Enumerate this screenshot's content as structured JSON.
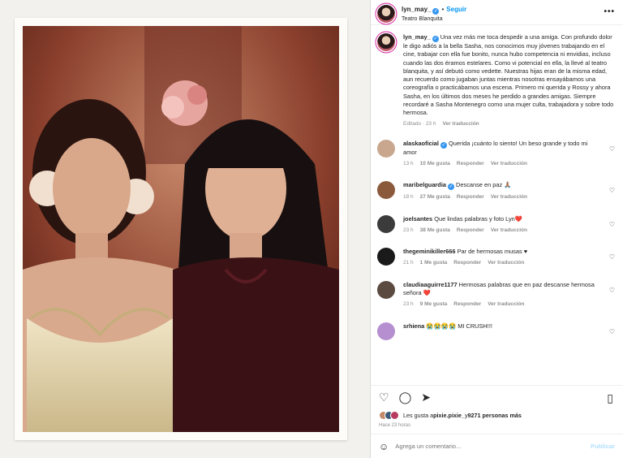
{
  "header": {
    "username": "lyn_may_",
    "follow_label": "Seguir",
    "dot": "•",
    "location": "Teatro Blanquita",
    "more_icon": "more-horizontal-icon"
  },
  "caption": {
    "username": "lyn_may_",
    "text": "Una vez más me toca despedir a una amiga. Con profundo dolor le digo adiós a la bella Sasha, nos conocimos muy jóvenes trabajando en el cine, trabajar con ella fue bonito, nunca hubo competencia ni envidias, incluso cuando las dos éramos estelares. Como vi potencial en ella, la llevé al teatro blanquita, y así debutó como vedette. Nuestras hijas eran de la misma edad, aun recuerdo como jugaban juntas mientras nosotras ensayábamos una coreografía o practicábamos una escena. Primero mi querida y Rossy y ahora Sasha, en los últimos dos meses he perdido a grandes amigas. Siempre recordaré a Sasha Montenegro como una mujer culta, trabajadora y sobre todo hermosa.",
    "edited": "Editado · 23 h",
    "translate": "Ver traducción"
  },
  "comments": [
    {
      "user": "alaskaoficial",
      "verified": true,
      "text": "Querida ¡cuánto lo siento! Un beso grande y todo mi amor",
      "time": "13 h",
      "likes": "10 Me gusta",
      "reply": "Responder",
      "translate": "Ver traducción",
      "avatar_color": "#c9a78f"
    },
    {
      "user": "maribelguardia",
      "verified": true,
      "text": "Descanse en paz 🙏🏽",
      "time": "18 h",
      "likes": "27 Me gusta",
      "reply": "Responder",
      "translate": "Ver traducción",
      "avatar_color": "#8b5a3c"
    },
    {
      "user": "joelsantes",
      "verified": false,
      "text": "Que lindas palabras y foto Lyn❤️",
      "time": "23 h",
      "likes": "38 Me gusta",
      "reply": "Responder",
      "translate": "Ver traducción",
      "avatar_color": "#3b3b3b"
    },
    {
      "user": "thegeminikiller666",
      "verified": false,
      "text": "Par de hermosas musas ♥",
      "time": "21 h",
      "likes": "1 Me gusta",
      "reply": "Responder",
      "translate": "Ver traducción",
      "avatar_color": "#1a1a1a"
    },
    {
      "user": "claudiaaguirre1177",
      "verified": false,
      "text": "Hermosas palabras que en paz descanse hermosa señora ❤️",
      "time": "23 h",
      "likes": "9 Me gusta",
      "reply": "Responder",
      "translate": "Ver traducción",
      "avatar_color": "#5a4a3f"
    },
    {
      "user": "srhiena",
      "verified": false,
      "text": "😭😭😭😭 MI CRUSH!!!",
      "time": "",
      "likes": "",
      "reply": "",
      "translate": "",
      "avatar_color": "#b58fd0"
    }
  ],
  "actions": {
    "like_icon": "heart-icon",
    "comment_icon": "comment-icon",
    "share_icon": "send-icon",
    "save_icon": "bookmark-icon"
  },
  "likes": {
    "prefix": "Les gusta a ",
    "user": "pixie.pixie_",
    "middle": " y ",
    "count": "9271 personas más"
  },
  "timestamp": "Hace 23 horas",
  "add_comment": {
    "placeholder": "Agrega un comentario...",
    "post_label": "Publicar",
    "emoji_icon": "emoji-icon"
  },
  "colors": {
    "link": "#0095f6",
    "verified": "#3897f0",
    "muted": "#8e8e8e"
  }
}
